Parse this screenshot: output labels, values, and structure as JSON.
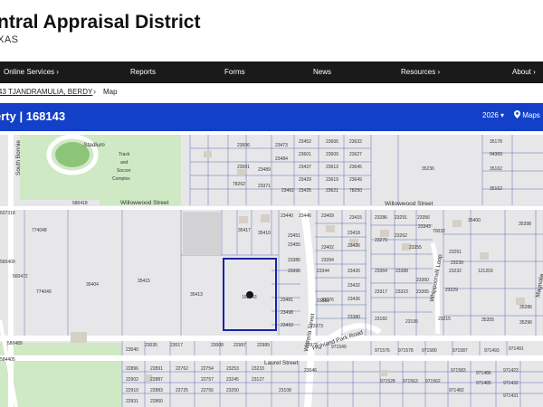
{
  "header": {
    "title": "ntral Appraisal District",
    "subtitle": "XAS"
  },
  "nav": {
    "items": [
      {
        "label": "Online Services",
        "chevron": "›"
      },
      {
        "label": "Reports"
      },
      {
        "label": "Forms"
      },
      {
        "label": "News"
      },
      {
        "label": "Resources",
        "chevron": "›"
      },
      {
        "label": "About",
        "chevron": "›"
      }
    ]
  },
  "breadcrumb": {
    "owner": "43 TJANDRAMULIA, BERDY",
    "separator": "›",
    "current": "Map"
  },
  "property": {
    "title": "erty | 168143",
    "year": "2026",
    "year_caret": "▾",
    "maps_label": "Maps",
    "pin_icon": "map-pin-icon"
  },
  "map": {
    "streets": {
      "willowwood_left": "Willowwood Street",
      "willowwood_right": "Willowwood Street",
      "laurel": "Laurel Street",
      "highland_park": "Highland Park Road",
      "wisteria": "Wisteria Street",
      "south_bonnie": "South Bonnie",
      "whippoorwill": "Whippoorwill Loop",
      "magnolia": "Magnolia"
    },
    "landmarks": {
      "stadium": "Stadium",
      "track": "Track",
      "and": "and",
      "soccer": "Soccer",
      "complex": "Complex"
    },
    "parcels": {
      "top_row": [
        "23606",
        "23473",
        "23452",
        "23606",
        "23632",
        "23484",
        "23601",
        "23609",
        "23627",
        "23501",
        "23489",
        "23437",
        "23613",
        "23645",
        "78262",
        "23371",
        "23429",
        "23619",
        "23649",
        "23461",
        "23425",
        "23621",
        "78250",
        "35178",
        "94369",
        "35162",
        "35236",
        "35162"
      ],
      "mid": [
        "35417",
        "35410",
        "23440",
        "23446",
        "23409",
        "23415",
        "23286",
        "23291",
        "23356",
        "23343",
        "23451",
        "23418",
        "23279",
        "23262",
        "70032",
        "23455",
        "23402",
        "23426",
        "23255",
        "23251",
        "23394",
        "35400",
        "23386",
        "35398",
        "23364",
        "23388",
        "23239",
        "23232",
        "121203",
        "23395",
        "23426",
        "23360",
        "23344"
      ],
      "left": [
        "774048",
        "560472",
        "774049",
        "35404",
        "35415",
        "35413",
        "168143",
        "23481",
        "23376",
        "23432",
        "23498",
        "23383",
        "23436",
        "23317",
        "23323",
        "23365",
        "23229",
        "23182",
        "23195",
        "23215",
        "35355",
        "35286",
        "23493",
        "23373",
        "23380",
        "35296"
      ],
      "bottom": [
        "23040",
        "23035",
        "23017",
        "23008",
        "22997",
        "22989",
        "22973",
        "971549",
        "971576",
        "971578",
        "971580",
        "971587",
        "971493",
        "971491",
        "22896",
        "22891",
        "22762",
        "22754",
        "23253",
        "23233",
        "23046",
        "22902",
        "22887",
        "22757",
        "23245",
        "23127",
        "22910",
        "22883",
        "22725",
        "23250",
        "23108",
        "22756",
        "971583",
        "971486",
        "971423",
        "971485",
        "971432",
        "971431",
        "971528",
        "971563",
        "971562",
        "971482",
        "22931",
        "22860"
      ],
      "far_left": [
        "637318",
        "580418",
        "580489",
        "560409",
        "584405"
      ]
    }
  }
}
